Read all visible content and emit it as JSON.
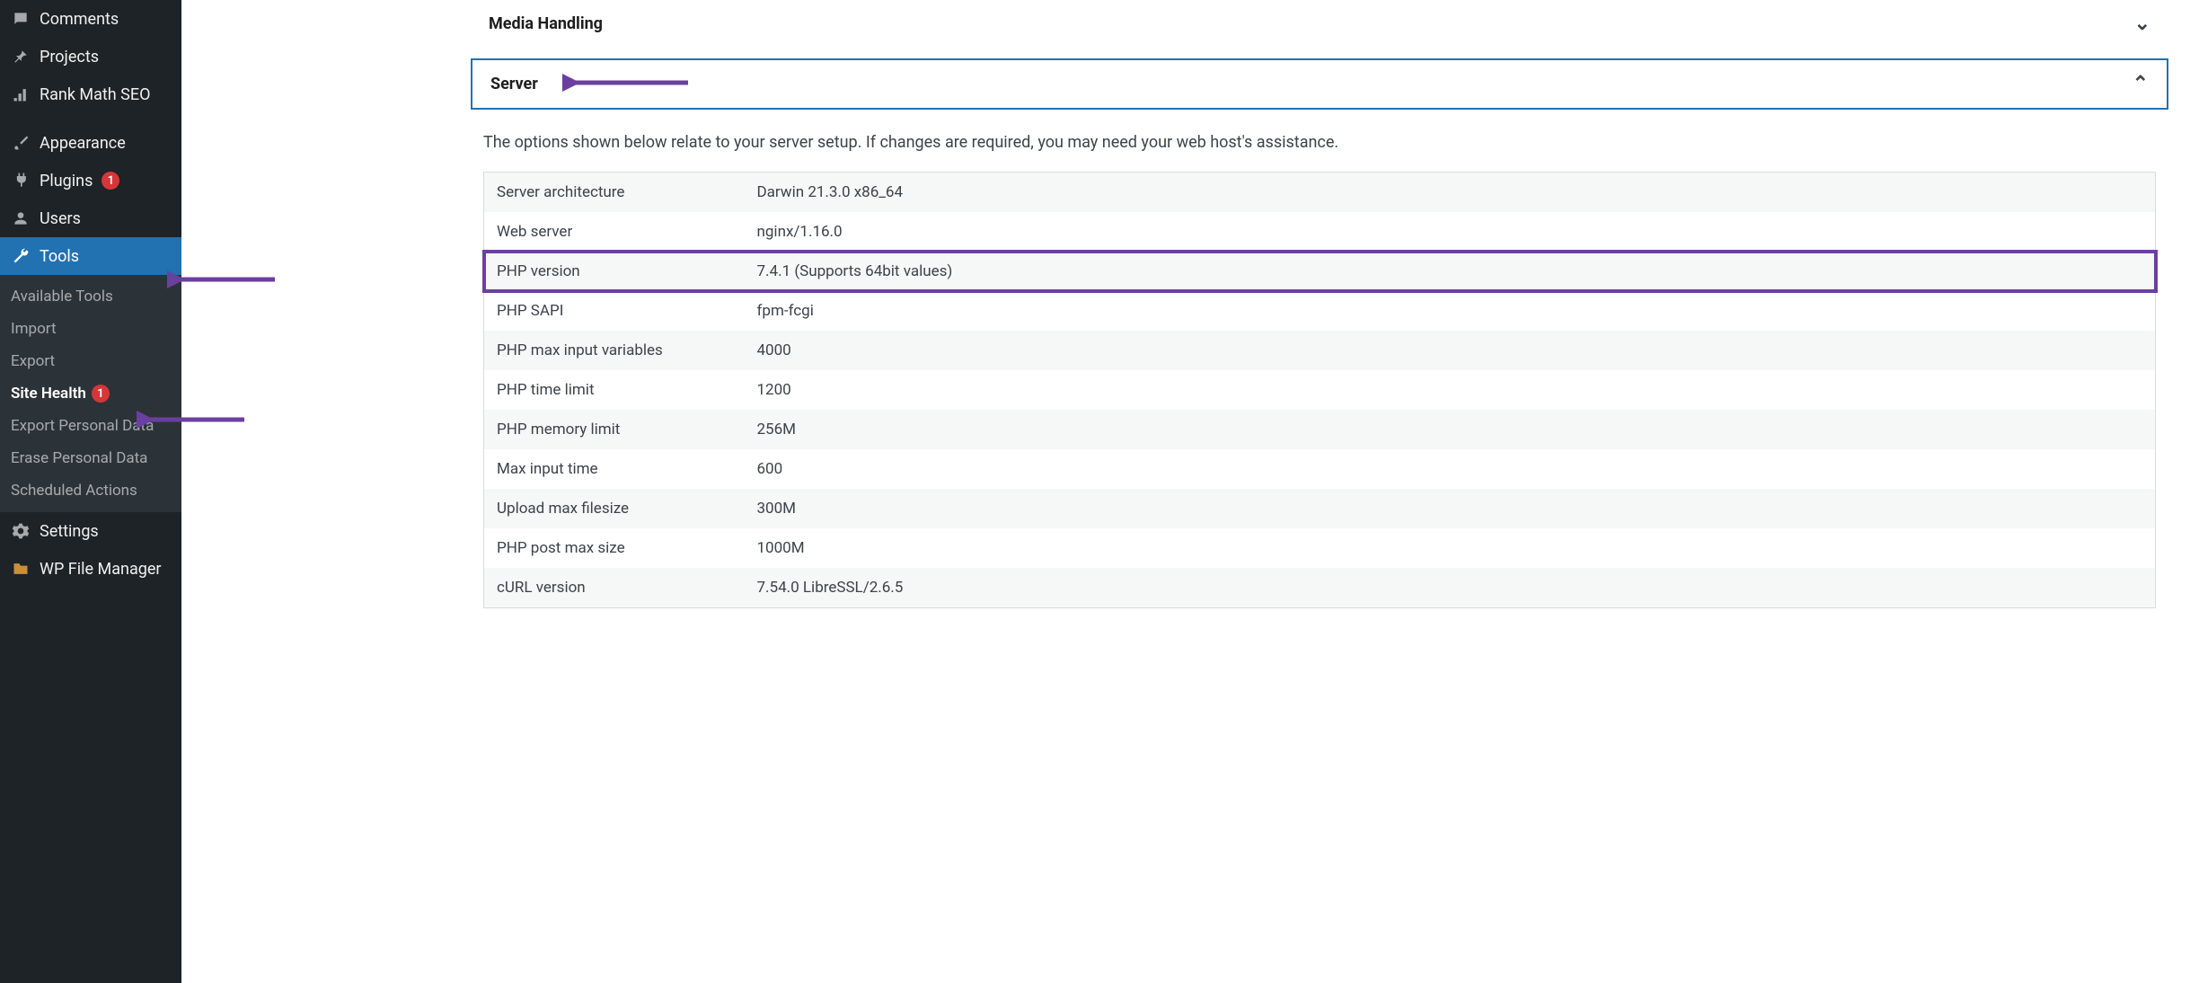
{
  "colors": {
    "accent": "#2271b1",
    "badge": "#d63638",
    "highlight": "#6b3fa0"
  },
  "sidebar": {
    "items": [
      {
        "icon": "comment-icon",
        "label": "Comments"
      },
      {
        "icon": "pin-icon",
        "label": "Projects"
      },
      {
        "icon": "chart-icon",
        "label": "Rank Math SEO"
      }
    ],
    "items2": [
      {
        "icon": "brush-icon",
        "label": "Appearance"
      },
      {
        "icon": "plug-icon",
        "label": "Plugins",
        "badge": "1"
      },
      {
        "icon": "user-icon",
        "label": "Users"
      },
      {
        "icon": "wrench-icon",
        "label": "Tools",
        "active": true
      }
    ],
    "submenu": [
      {
        "label": "Available Tools"
      },
      {
        "label": "Import"
      },
      {
        "label": "Export"
      },
      {
        "label": "Site Health",
        "current": true,
        "badge": "1"
      },
      {
        "label": "Export Personal Data"
      },
      {
        "label": "Erase Personal Data"
      },
      {
        "label": "Scheduled Actions"
      }
    ],
    "items3": [
      {
        "icon": "settings-icon",
        "label": "Settings"
      },
      {
        "icon": "folder-icon",
        "label": "WP File Manager"
      }
    ]
  },
  "panels": {
    "media": {
      "title": "Media Handling"
    },
    "server": {
      "title": "Server",
      "desc": "The options shown below relate to your server setup. If changes are required, you may need your web host's assistance.",
      "rows": [
        {
          "key": "Server architecture",
          "value": "Darwin 21.3.0 x86_64"
        },
        {
          "key": "Web server",
          "value": "nginx/1.16.0"
        },
        {
          "key": "PHP version",
          "value": "7.4.1 (Supports 64bit values)",
          "highlight": true
        },
        {
          "key": "PHP SAPI",
          "value": "fpm-fcgi"
        },
        {
          "key": "PHP max input variables",
          "value": "4000"
        },
        {
          "key": "PHP time limit",
          "value": "1200"
        },
        {
          "key": "PHP memory limit",
          "value": "256M"
        },
        {
          "key": "Max input time",
          "value": "600"
        },
        {
          "key": "Upload max filesize",
          "value": "300M"
        },
        {
          "key": "PHP post max size",
          "value": "1000M"
        },
        {
          "key": "cURL version",
          "value": "7.54.0 LibreSSL/2.6.5"
        }
      ]
    }
  }
}
